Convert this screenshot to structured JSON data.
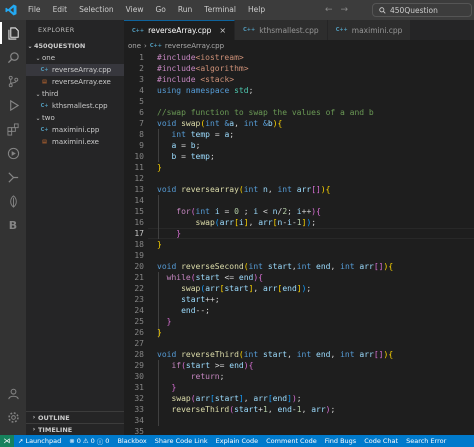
{
  "menu": [
    "File",
    "Edit",
    "Selection",
    "View",
    "Go",
    "Run",
    "Terminal",
    "Help"
  ],
  "search": {
    "text": "450Question"
  },
  "sidebar": {
    "title": "EXPLORER",
    "root": "450QUESTION",
    "tree": [
      {
        "label": "one",
        "type": "folder",
        "depth": 1
      },
      {
        "label": "reverseArray.cpp",
        "type": "cpp",
        "depth": 2,
        "selected": true
      },
      {
        "label": "reverseArray.exe",
        "type": "exe",
        "depth": 2
      },
      {
        "label": "third",
        "type": "folder",
        "depth": 1
      },
      {
        "label": "kthsmallest.cpp",
        "type": "cpp",
        "depth": 2
      },
      {
        "label": "two",
        "type": "folder",
        "depth": 1
      },
      {
        "label": "maximini.cpp",
        "type": "cpp",
        "depth": 2
      },
      {
        "label": "maximini.exe",
        "type": "exe",
        "depth": 2
      }
    ],
    "outline": "OUTLINE",
    "timeline": "TIMELINE"
  },
  "tabs": [
    {
      "label": "reverseArray.cpp",
      "active": true
    },
    {
      "label": "kthsmallest.cpp",
      "active": false
    },
    {
      "label": "maximini.cpp",
      "active": false
    }
  ],
  "breadcrumb": [
    "one",
    "reverseArray.cpp"
  ],
  "editor": {
    "active_line": 17,
    "line_count": 35
  },
  "statusbar": {
    "launchpad": "Launchpad",
    "errors": "0",
    "warnings": "0",
    "info": "0",
    "items": [
      "Blackbox",
      "Share Code Link",
      "Explain Code",
      "Comment Code",
      "Find Bugs",
      "Code Chat",
      "Search Error"
    ]
  },
  "colors": {
    "accent": "#007acc",
    "activitybar": "#333333",
    "sidebar": "#252526",
    "editor": "#1e1e1e"
  }
}
